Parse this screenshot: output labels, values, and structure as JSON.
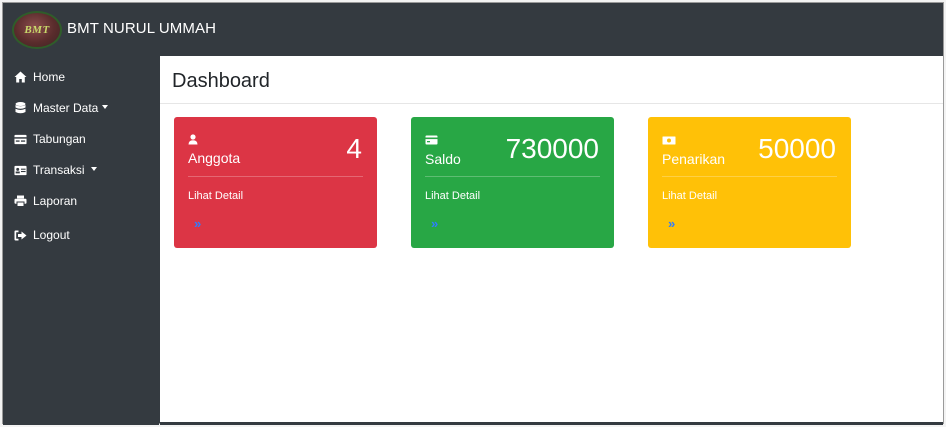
{
  "brand": {
    "logo_text": "BMT",
    "title": "BMT NURUL UMMAH"
  },
  "sidebar": {
    "items": [
      {
        "label": "Home",
        "icon": "home-icon"
      },
      {
        "label": "Master Data",
        "icon": "database-icon",
        "has_caret": true
      },
      {
        "label": "Tabungan",
        "icon": "card-icon"
      },
      {
        "label": "Transaksi",
        "icon": "id-card-icon",
        "has_caret": true
      },
      {
        "label": "Laporan",
        "icon": "print-icon"
      },
      {
        "label": "Logout",
        "icon": "sign-out-icon"
      }
    ]
  },
  "main": {
    "title": "Dashboard",
    "cards": [
      {
        "label": "Anggota",
        "value": "4",
        "link": "Lihat Detail",
        "icon": "user-icon",
        "color": "#dc3545"
      },
      {
        "label": "Saldo",
        "value": "730000",
        "link": "Lihat Detail",
        "icon": "credit-card-icon",
        "color": "#28a745"
      },
      {
        "label": "Penarikan",
        "value": "50000",
        "link": "Lihat Detail",
        "icon": "money-bill-icon",
        "color": "#ffc107"
      }
    ],
    "chevron": "»"
  },
  "colors": {
    "dark": "#343a40",
    "link_chevron": "#2f7dff"
  }
}
